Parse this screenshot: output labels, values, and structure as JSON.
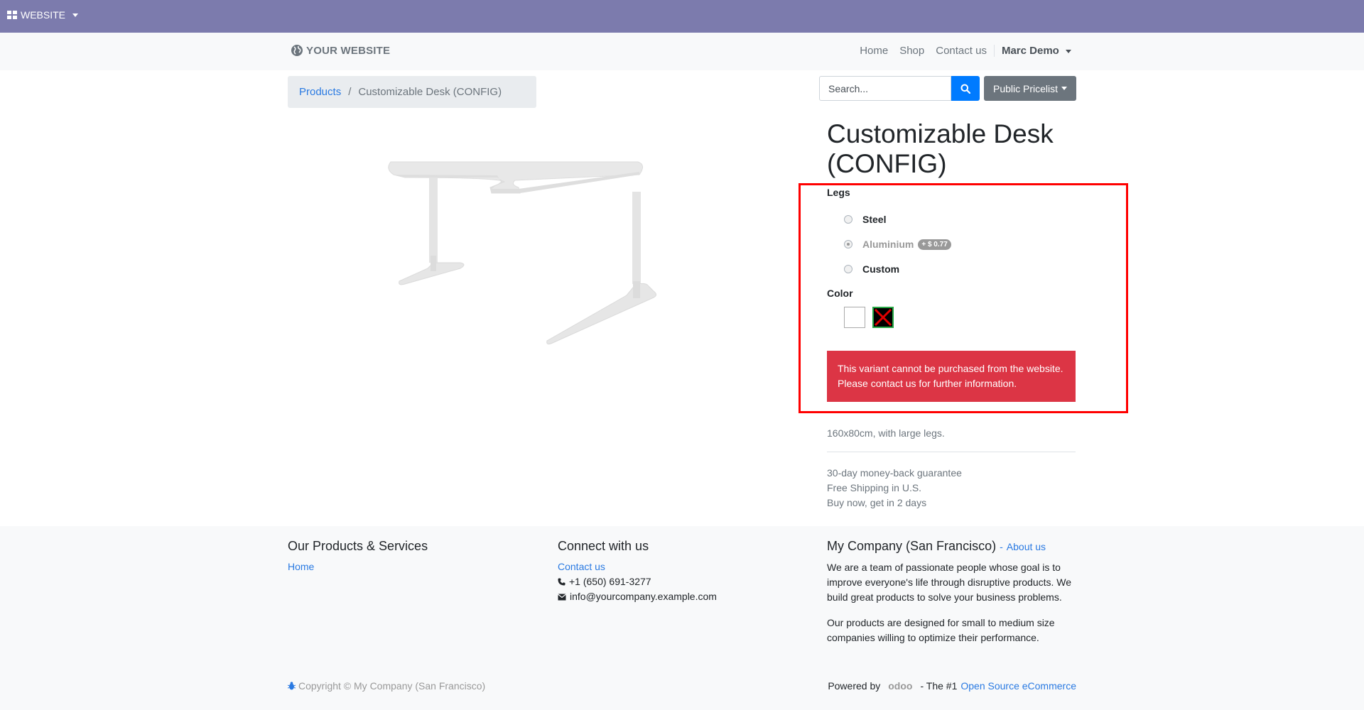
{
  "admin_bar": {
    "app_label": "WEBSITE"
  },
  "header": {
    "logo_text": "YOUR WEBSITE",
    "nav": [
      {
        "label": "Home"
      },
      {
        "label": "Shop"
      },
      {
        "label": "Contact us"
      }
    ],
    "user": "Marc Demo"
  },
  "breadcrumb": {
    "parent": "Products",
    "separator": "/",
    "current": "Customizable Desk (CONFIG)"
  },
  "search": {
    "placeholder": "Search...",
    "value": ""
  },
  "pricelist": {
    "label": "Public Pricelist"
  },
  "product": {
    "title": "Customizable Desk (CONFIG)",
    "attributes": {
      "legs_label": "Legs",
      "options": [
        {
          "label": "Steel",
          "checked": false
        },
        {
          "label": "Aluminium",
          "checked": true,
          "price_extra": "+ $ 0.77"
        },
        {
          "label": "Custom",
          "checked": false
        }
      ],
      "color_label": "Color",
      "colors": [
        "#ffffff",
        "#000000"
      ]
    },
    "alert": "This variant cannot be purchased from the website. Please contact us for further information.",
    "description": "160x80cm, with large legs.",
    "perks": [
      "30-day money-back guarantee",
      "Free Shipping in U.S.",
      "Buy now, get in 2 days"
    ]
  },
  "footer": {
    "products": {
      "title": "Our Products & Services",
      "link": "Home"
    },
    "connect": {
      "title": "Connect with us",
      "link": "Contact us",
      "phone": "+1 (650) 691-3277",
      "email": "info@yourcompany.example.com"
    },
    "company": {
      "title": "My Company (San Francisco)",
      "about_prefix": "-",
      "about_link": "About us",
      "para1": "We are a team of passionate people whose goal is to improve everyone's life through disruptive products. We build great products to solve your business problems.",
      "para2": "Our products are designed for small to medium size companies willing to optimize their performance."
    },
    "copyright": "Copyright © My Company (San Francisco)",
    "powered_by": "Powered by",
    "odoo": "odoo",
    "tagline": "- The #1",
    "tagline_link": "Open Source eCommerce"
  },
  "colors": {
    "admin_bar": "#7c7bad",
    "accent": "#007bff",
    "alert": "#dc3545",
    "highlight": "#ff0000"
  }
}
